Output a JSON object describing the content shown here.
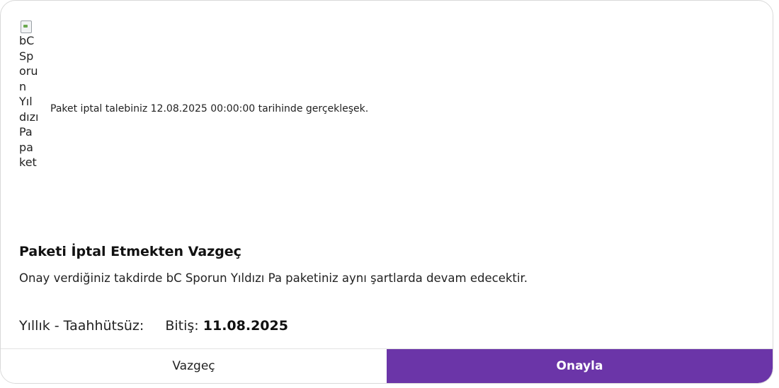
{
  "image_alt_lines": [
    "bC",
    "Sp",
    "oru",
    "n",
    "Yıl",
    "dızı",
    "Pa",
    "pa",
    "ket"
  ],
  "notice": "Paket iptal talebiniz 12.08.2025 00:00:00 tarihinde gerçekleşek.",
  "title": "Paketi İptal Etmekten Vazgeç",
  "description": "Onay verdiğiniz takdirde bC Sporun Yıldızı Pa paketiniz aynı şartlarda devam edecektir.",
  "plan": {
    "type": "Yıllık - Taahhütsüz:",
    "end_label": "Bitiş:",
    "end_date": "11.08.2025"
  },
  "buttons": {
    "cancel": "Vazgeç",
    "confirm": "Onayla"
  },
  "colors": {
    "accent": "#6b35a8"
  }
}
